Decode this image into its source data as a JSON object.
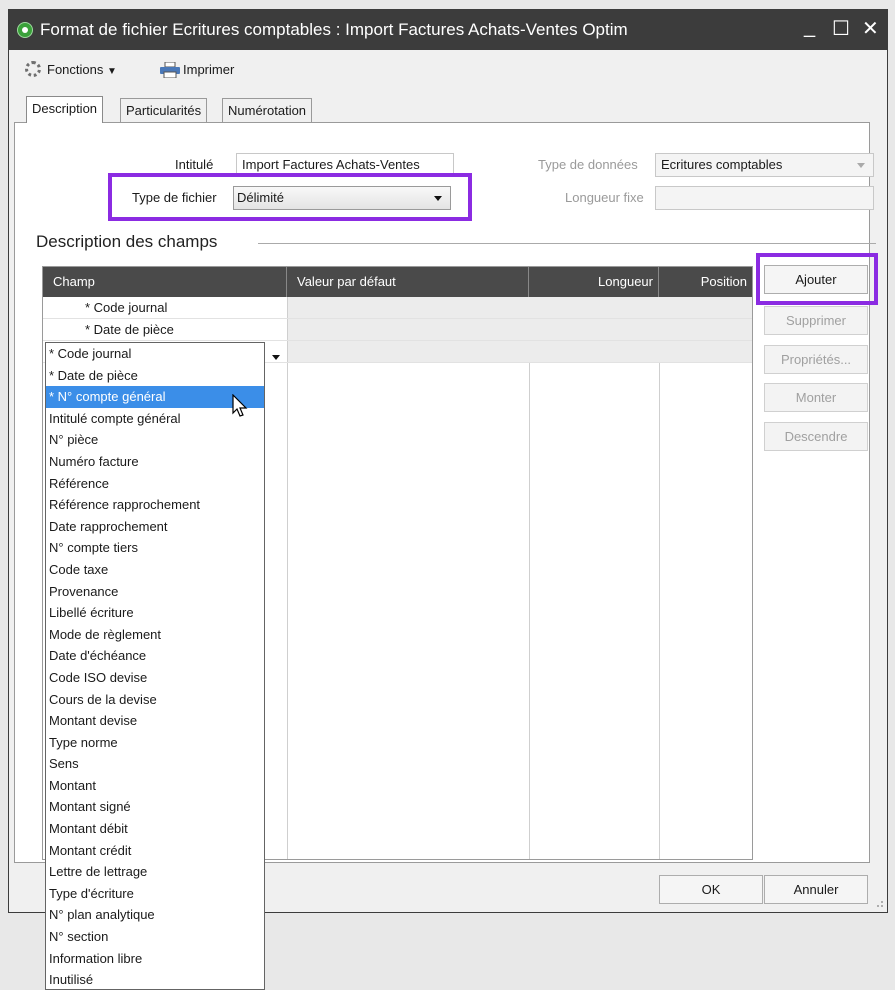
{
  "window": {
    "title": "Format de fichier Ecritures comptables : Import Factures Achats-Ventes Optim",
    "minimize_glyph": "_",
    "maximize_glyph": "☐",
    "close_glyph": "✕"
  },
  "toolbar": {
    "fonctions_label": "Fonctions",
    "imprimer_label": "Imprimer"
  },
  "tabs": [
    {
      "label": "Description",
      "active": true
    },
    {
      "label": "Particularités",
      "active": false
    },
    {
      "label": "Numérotation",
      "active": false
    }
  ],
  "form": {
    "intitule_label": "Intitulé",
    "intitule_value": "Import Factures Achats-Ventes",
    "type_fichier_label": "Type de fichier",
    "type_fichier_value": "Délimité",
    "type_donnees_label": "Type de données",
    "type_donnees_value": "Ecritures comptables",
    "longueur_fixe_label": "Longueur fixe",
    "longueur_fixe_value": ""
  },
  "section_title": "Description des champs",
  "grid": {
    "columns": [
      "Champ",
      "Valeur par défaut",
      "Longueur",
      "Position"
    ],
    "rows": [
      {
        "champ": "* Code journal"
      },
      {
        "champ": "* Date de pièce"
      },
      {
        "champ": ""
      }
    ]
  },
  "buttons": {
    "ajouter": "Ajouter",
    "supprimer": "Supprimer",
    "proprietes": "Propriétés...",
    "monter": "Monter",
    "descendre": "Descendre",
    "ok": "OK",
    "annuler": "Annuler"
  },
  "dropdown": {
    "selected_index": 2,
    "options": [
      "* Code journal",
      "* Date de pièce",
      "* N° compte général",
      "Intitulé compte général",
      "N° pièce",
      "Numéro facture",
      "Référence",
      "Référence rapprochement",
      "Date rapprochement",
      "N° compte tiers",
      "Code taxe",
      "Provenance",
      "Libellé écriture",
      "Mode de règlement",
      "Date d'échéance",
      "Code ISO devise",
      "Cours de la devise",
      "Montant devise",
      "Type norme",
      "Sens",
      "Montant",
      "Montant signé",
      "Montant débit",
      "Montant crédit",
      "Lettre de lettrage",
      "Type d'écriture",
      "N° plan analytique",
      "N° section",
      "Information libre",
      "Inutilisé"
    ]
  },
  "colors": {
    "highlight": "#8b2be2",
    "selection": "#3b8ee8",
    "titlebar": "#3c3c3c",
    "grid_header": "#4a4a4a"
  },
  "icons": [
    "app-icon",
    "gear-icon",
    "printer-icon",
    "mouse-cursor-icon"
  ]
}
